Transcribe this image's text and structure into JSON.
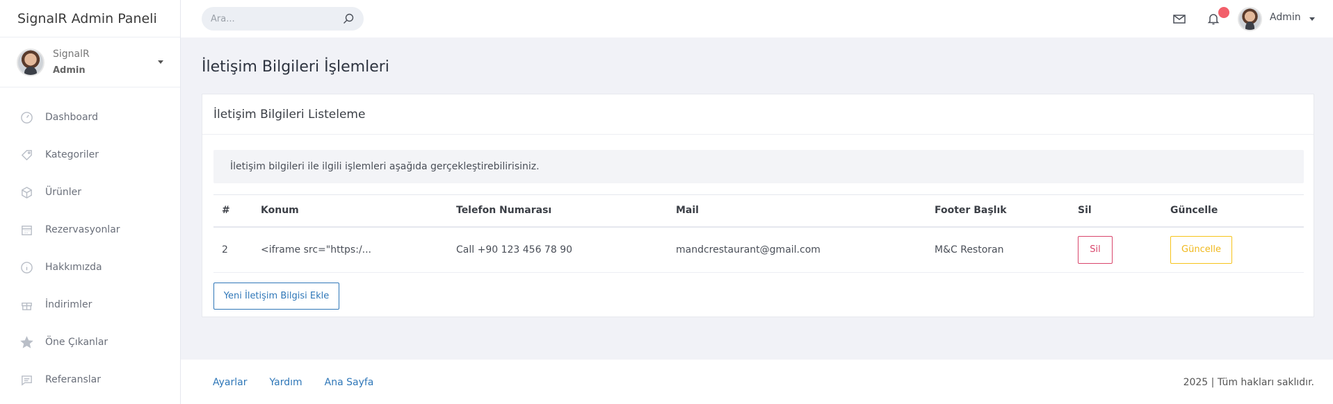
{
  "app": {
    "brand": "SignalR Admin Paneli"
  },
  "profile": {
    "name": "SignalR",
    "role": "Admin"
  },
  "sidebar": {
    "items": [
      {
        "label": "Dashboard",
        "icon": "gauge-icon"
      },
      {
        "label": "Kategoriler",
        "icon": "tag-icon"
      },
      {
        "label": "Ürünler",
        "icon": "box-icon"
      },
      {
        "label": "Rezervasyonlar",
        "icon": "calendar-icon"
      },
      {
        "label": "Hakkımızda",
        "icon": "info-icon"
      },
      {
        "label": "İndirimler",
        "icon": "gift-icon"
      },
      {
        "label": "Öne Çıkanlar",
        "icon": "star-icon"
      },
      {
        "label": "Referanslar",
        "icon": "message-icon"
      }
    ]
  },
  "header": {
    "search_placeholder": "Ara...",
    "user_name": "Admin",
    "notification_color": "#f25f6a"
  },
  "page": {
    "title": "İletişim Bilgileri İşlemleri",
    "card_title": "İletişim Bilgileri Listeleme",
    "info_text": "İletişim bilgileri ile ilgili işlemleri aşağıda gerçekleştirebilirisiniz.",
    "table": {
      "columns": [
        "#",
        "Konum",
        "Telefon Numarası",
        "Mail",
        "Footer Başlık",
        "Sil",
        "Güncelle"
      ],
      "rows": [
        {
          "id": "2",
          "konum": "<iframe src=\"https:/...",
          "telefon": "Call +90 123 456 78 90",
          "mail": "mandcrestaurant@gmail.com",
          "footer_baslik": "M&C Restoran",
          "sil_label": "Sil",
          "guncelle_label": "Güncelle"
        }
      ]
    },
    "new_button": "Yeni İletişim Bilgisi Ekle"
  },
  "footer": {
    "links": [
      "Ayarlar",
      "Yardım",
      "Ana Sayfa"
    ],
    "copyright": "2025 | Tüm hakları saklıdır."
  },
  "colors": {
    "primary": "#2f77b8",
    "danger": "#d9456b",
    "warning": "#f6c31a"
  }
}
